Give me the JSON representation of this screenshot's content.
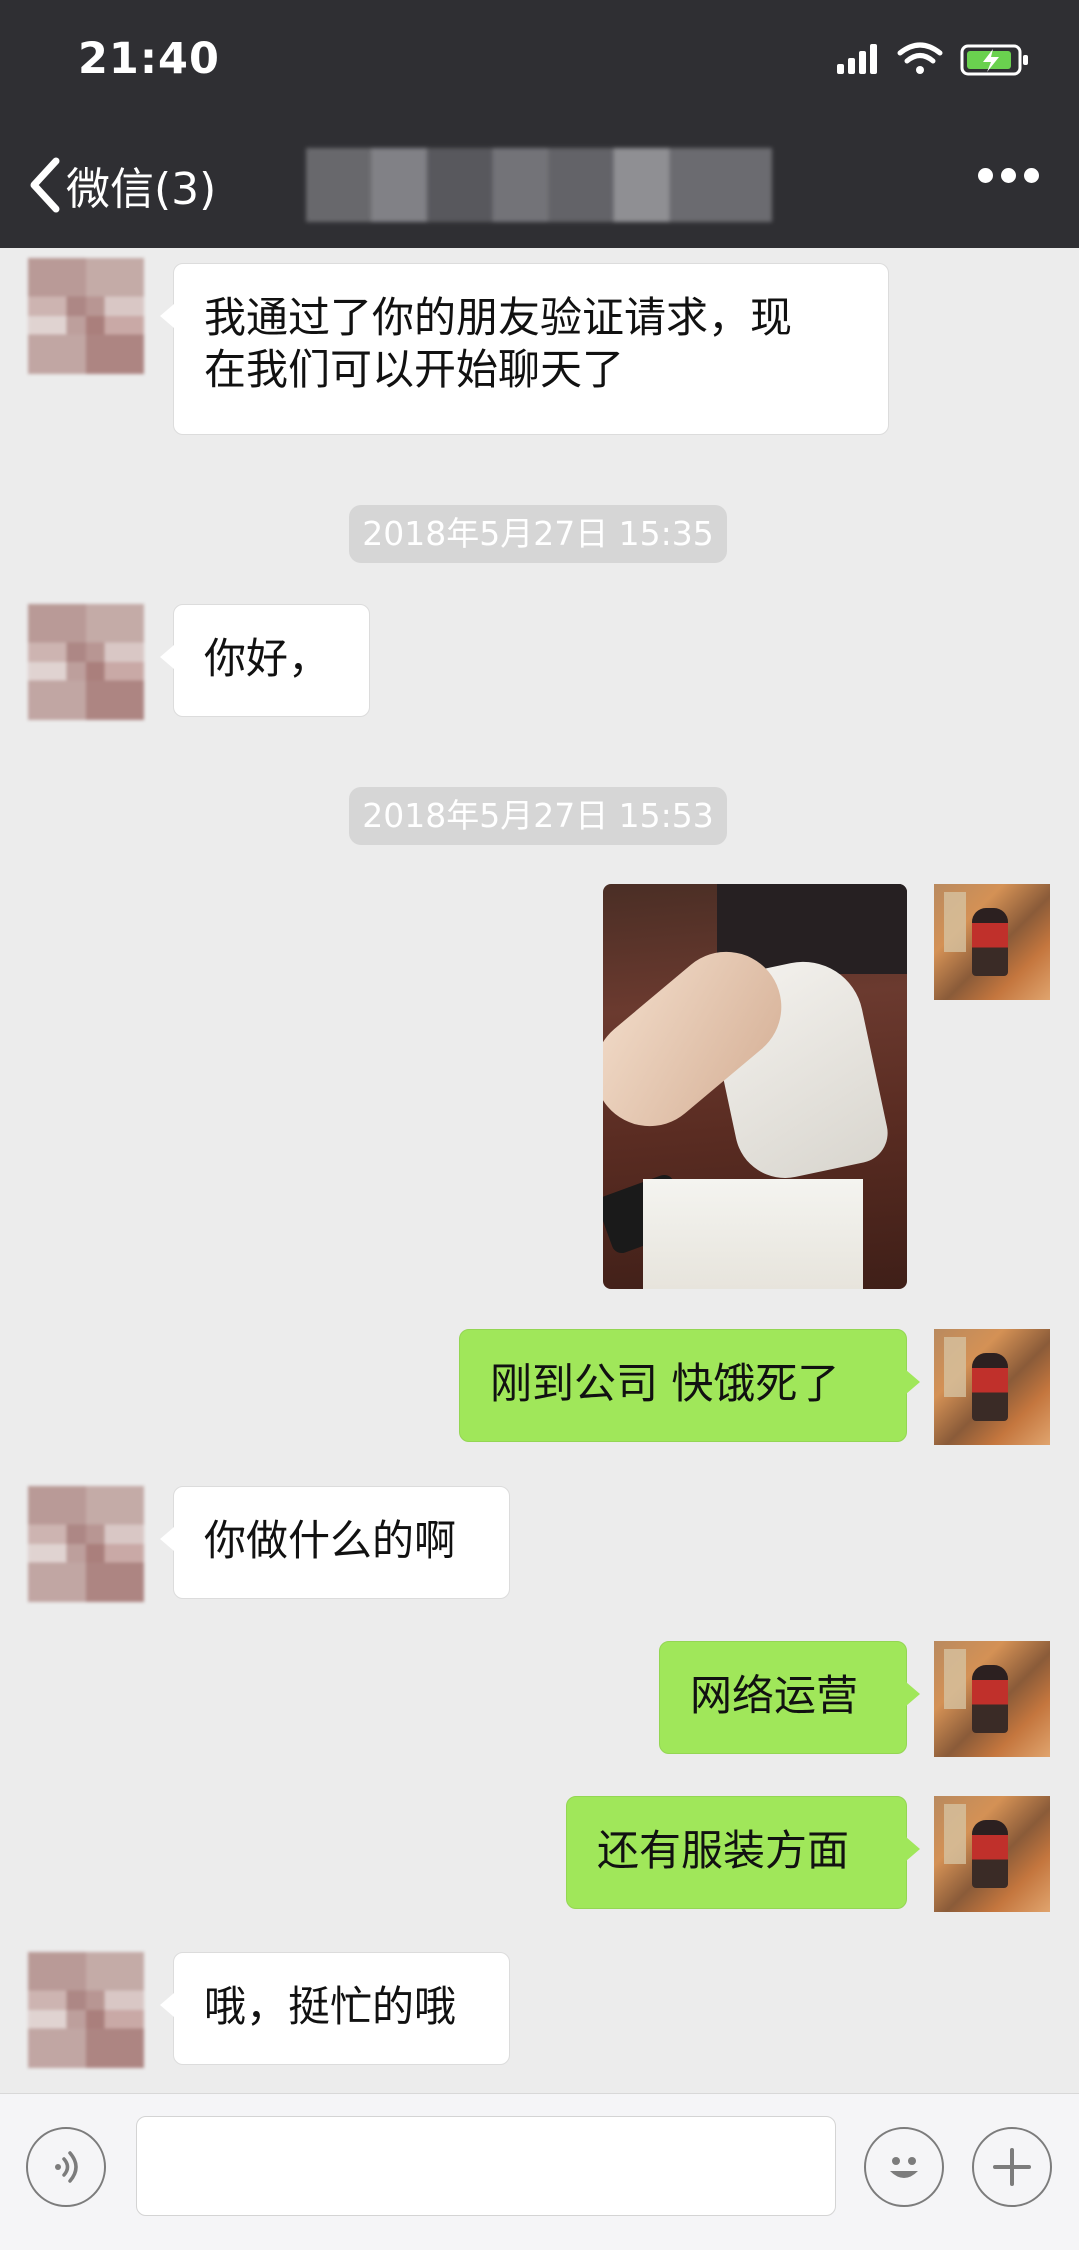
{
  "status_bar": {
    "time": "21:40",
    "icons": [
      "signal-icon",
      "wifi-icon",
      "battery-charging-icon"
    ]
  },
  "nav": {
    "back_label": "微信(3)",
    "more_icon": "more-icon"
  },
  "messages": [
    {
      "type": "text",
      "from": "contact",
      "text_lines": [
        "我通过了你的朋友验证请求，现",
        "在我们可以开始聊天了"
      ]
    },
    {
      "type": "timestamp",
      "text": "2018年5月27日 15:35"
    },
    {
      "type": "text",
      "from": "contact",
      "text": "你好，"
    },
    {
      "type": "timestamp",
      "text": "2018年5月27日 15:53"
    },
    {
      "type": "image",
      "from": "me"
    },
    {
      "type": "text",
      "from": "me",
      "text": "刚到公司 快饿死了"
    },
    {
      "type": "text",
      "from": "contact",
      "text": "你做什么的啊"
    },
    {
      "type": "text",
      "from": "me",
      "text": "网络运营"
    },
    {
      "type": "text",
      "from": "me",
      "text": "还有服装方面"
    },
    {
      "type": "text",
      "from": "contact",
      "text": "哦，挺忙的哦"
    }
  ],
  "input_bar": {
    "voice_icon": "voice-icon",
    "input_value": "",
    "emoji_icon": "emoji-icon",
    "plus_icon": "plus-icon"
  },
  "colors": {
    "header_bg": "#2f2f33",
    "chat_bg": "#ececec",
    "incoming_bubble": "#ffffff",
    "outgoing_bubble": "#a0e75a",
    "timestamp_bg": "#d6d6d6"
  }
}
